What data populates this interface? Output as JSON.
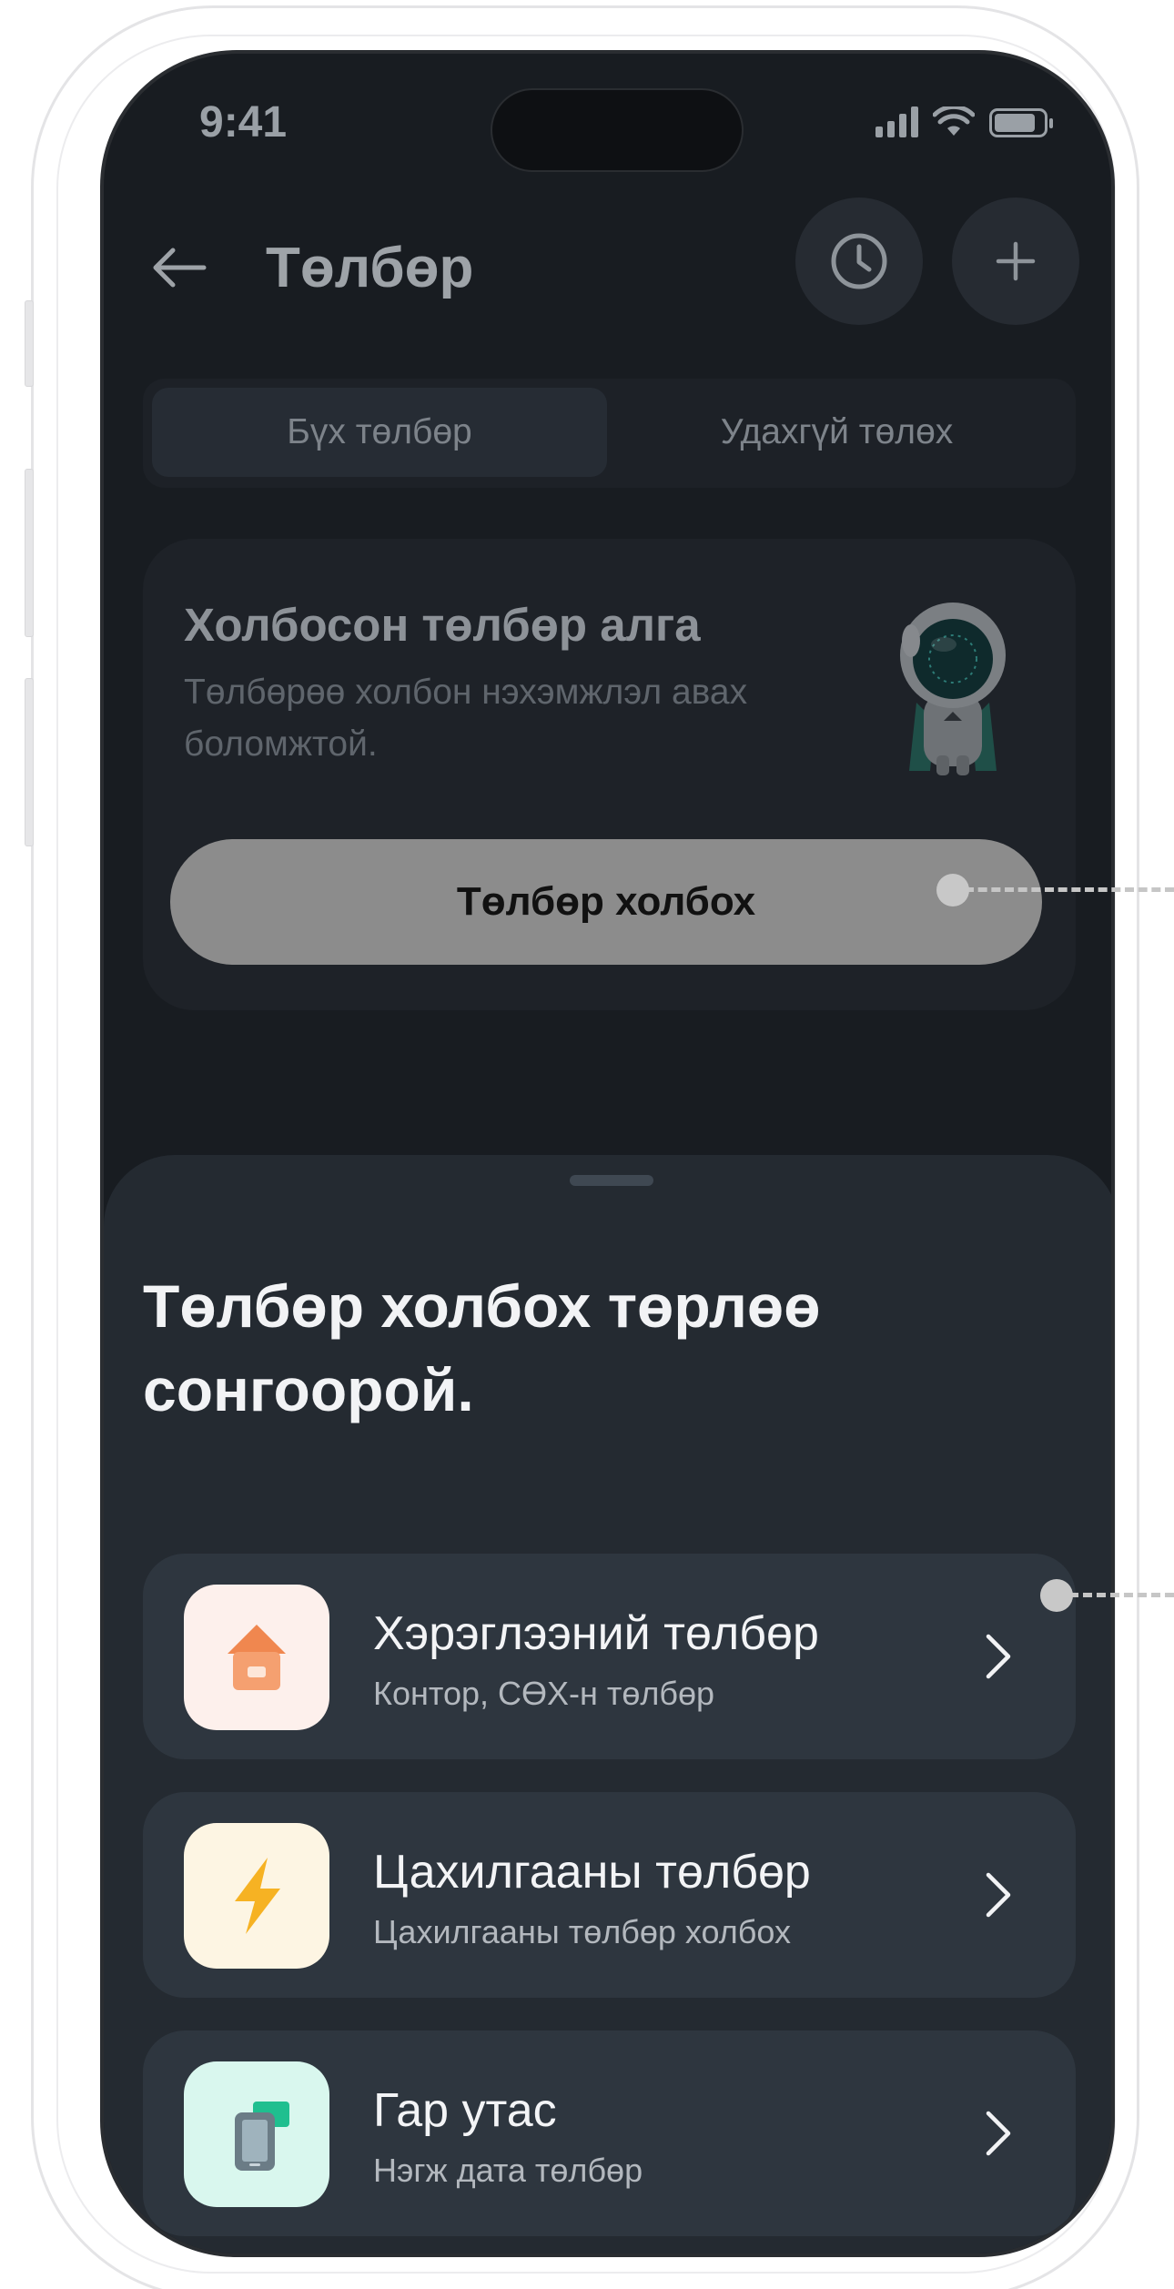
{
  "status_bar": {
    "time": "9:41"
  },
  "header": {
    "title": "Төлбөр"
  },
  "tabs": [
    {
      "label": "Бүх төлбөр",
      "active": true
    },
    {
      "label": "Удахгүй төлөх",
      "active": false
    }
  ],
  "empty_state": {
    "title": "Холбосон төлбөр алга",
    "subtitle": "Төлбөрөө холбон нэхэмжлэл авах боломжтой.",
    "button_label": "Төлбөр холбох"
  },
  "sheet": {
    "title": "Төлбөр холбох төрлөө сонгоорой.",
    "options": [
      {
        "title": "Хэрэглээний төлбөр",
        "subtitle": "Контор, СӨХ-н төлбөр",
        "icon": "house-icon"
      },
      {
        "title": "Цахилгааны төлбөр",
        "subtitle": "Цахилгааны төлбөр холбох",
        "icon": "lightning-icon"
      },
      {
        "title": "Гар утас",
        "subtitle": "Нэгж дата төлбөр",
        "icon": "phone-sim-icon"
      }
    ]
  },
  "colors": {
    "background": "#181c21",
    "sheet": "#242a31",
    "option_card": "#2e363f",
    "primary_button_disabled": "#8c8c8c"
  }
}
